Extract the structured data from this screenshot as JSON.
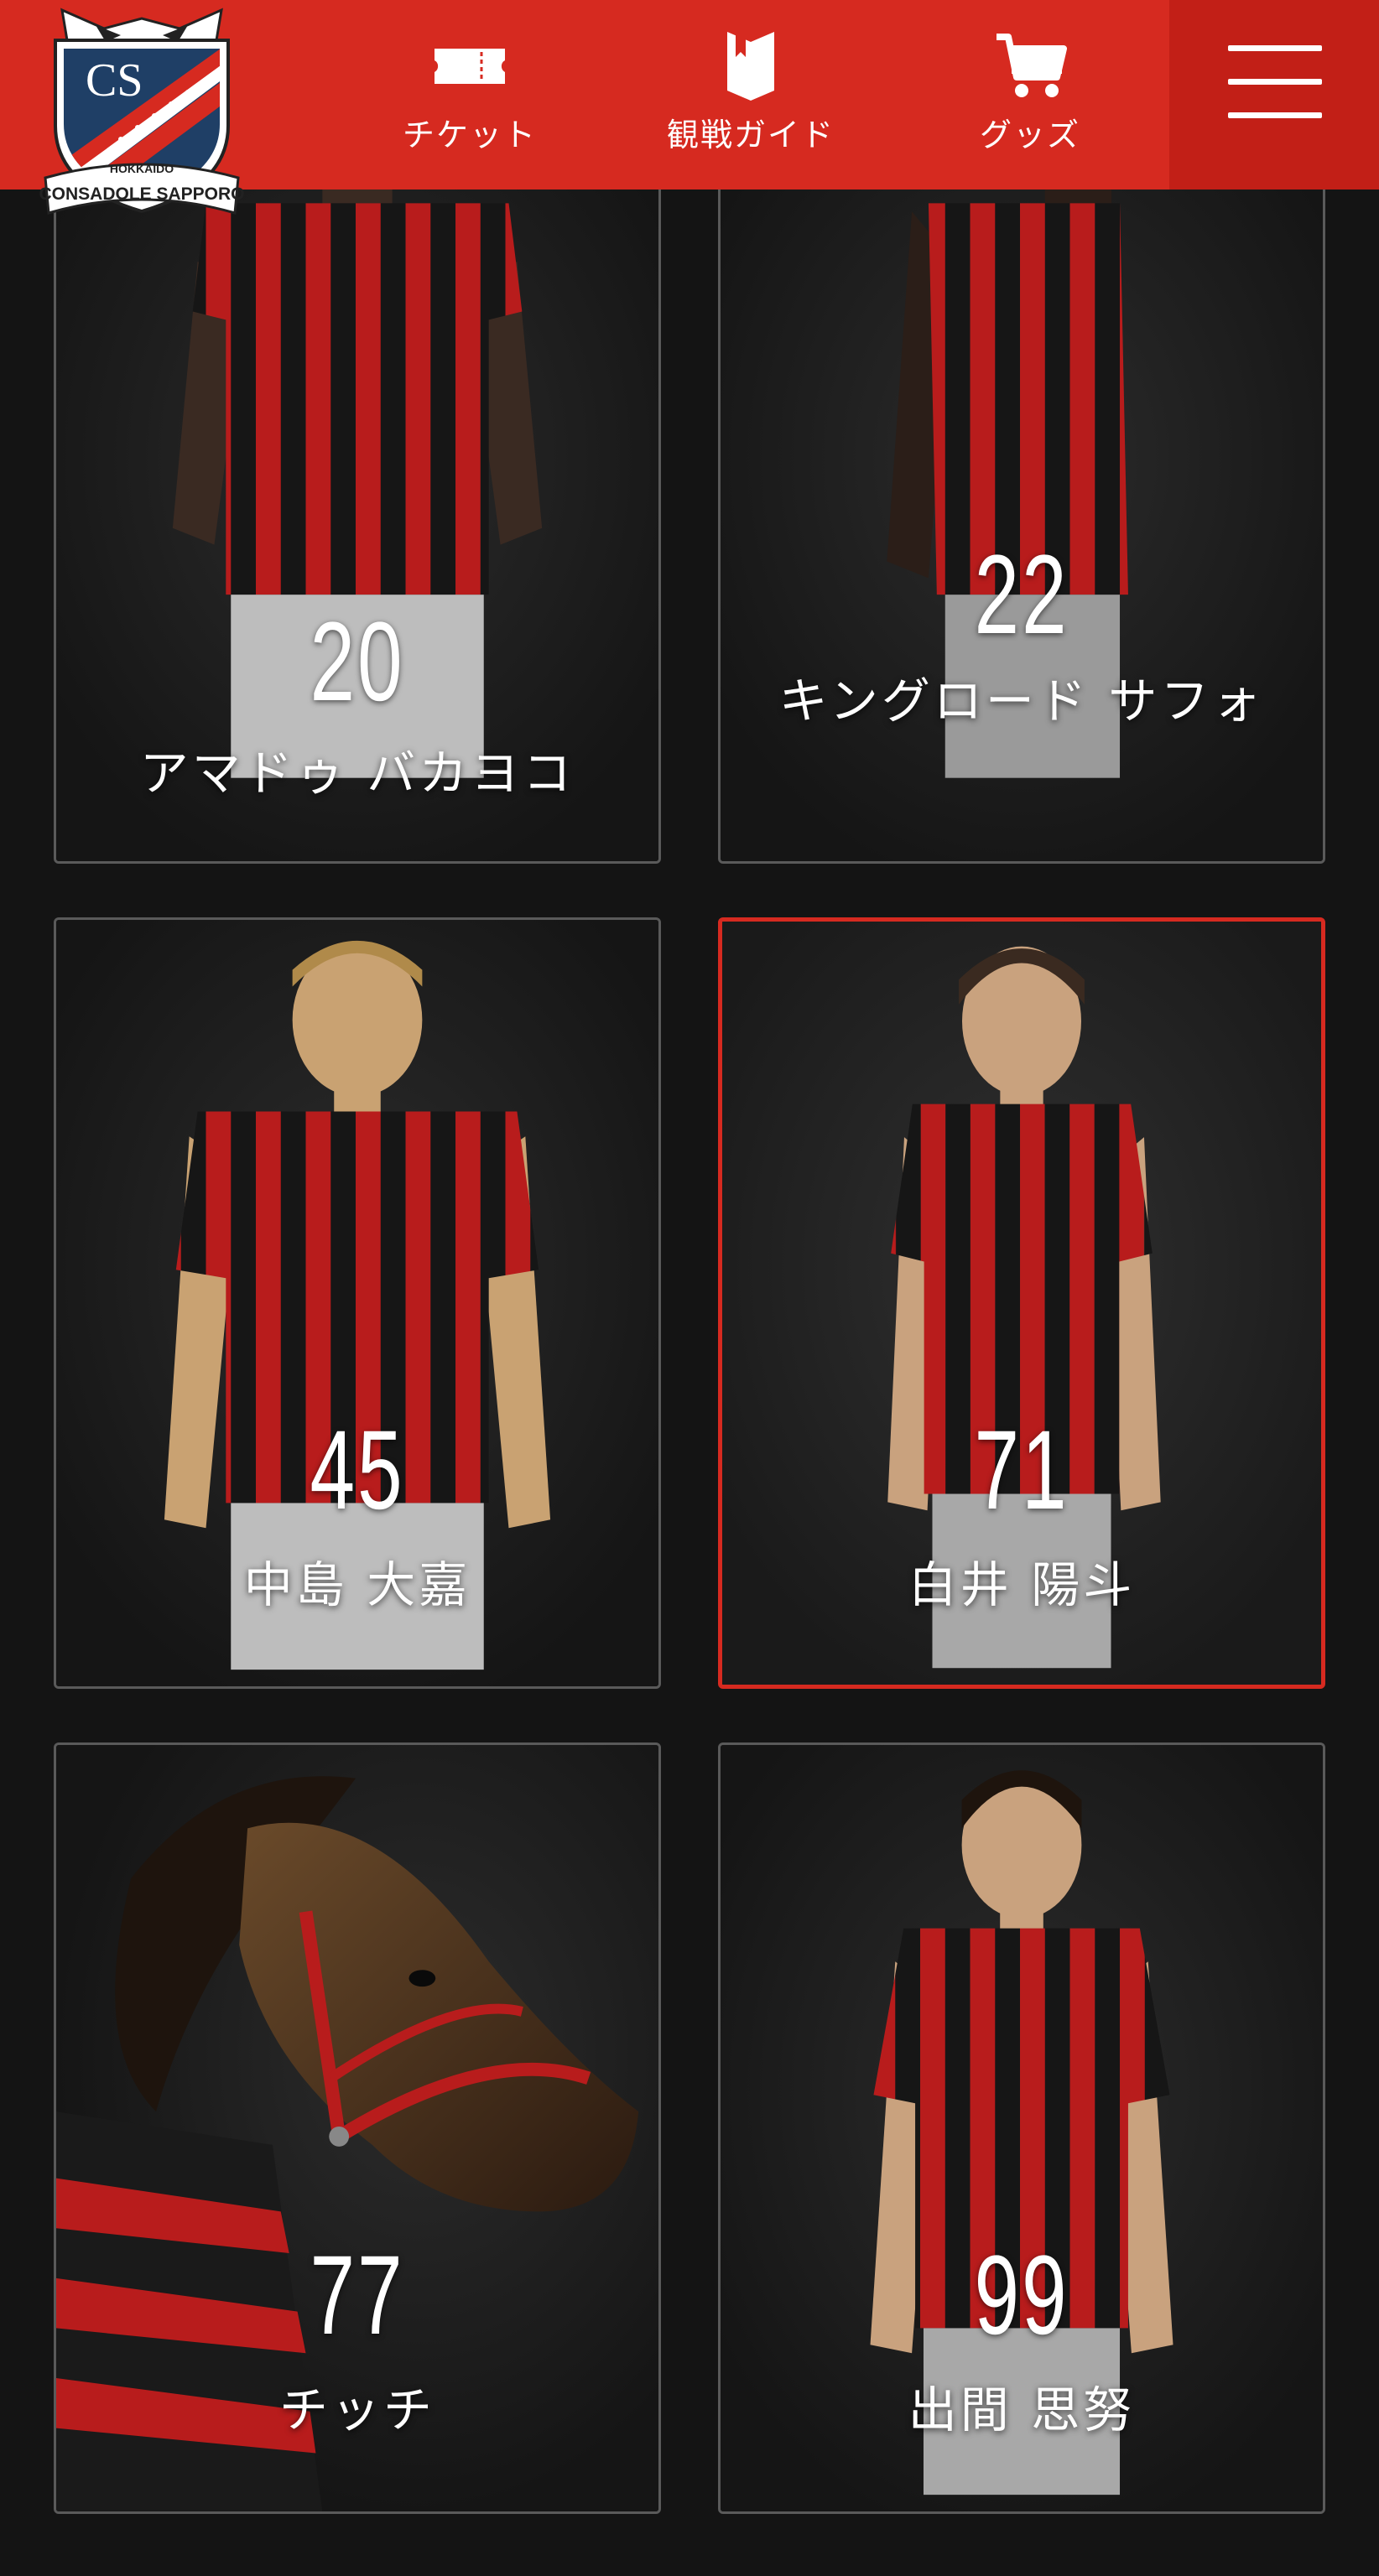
{
  "header": {
    "logo_text": "CONSADOLE SAPPORO",
    "logo_top_text": "HOKKAIDO",
    "nav": [
      {
        "label": "チケット",
        "icon": "ticket-icon"
      },
      {
        "label": "観戦ガイド",
        "icon": "guide-book-icon"
      },
      {
        "label": "グッズ",
        "icon": "cart-icon"
      }
    ],
    "menu_icon": "hamburger-menu-icon"
  },
  "colors": {
    "header_red": "#d62a20",
    "menu_red": "#c21f17",
    "background": "#141414",
    "active_border": "#d62a20"
  },
  "players": [
    {
      "number": "20",
      "name": "アマドゥ バカヨコ",
      "active": false
    },
    {
      "number": "22",
      "name": "キングロード サフォ",
      "active": false
    },
    {
      "number": "45",
      "name": "中島 大嘉",
      "active": false
    },
    {
      "number": "71",
      "name": "白井 陽斗",
      "active": true
    },
    {
      "number": "77",
      "name": "チッチ",
      "active": false
    },
    {
      "number": "99",
      "name": "出間 思努",
      "active": false
    }
  ]
}
